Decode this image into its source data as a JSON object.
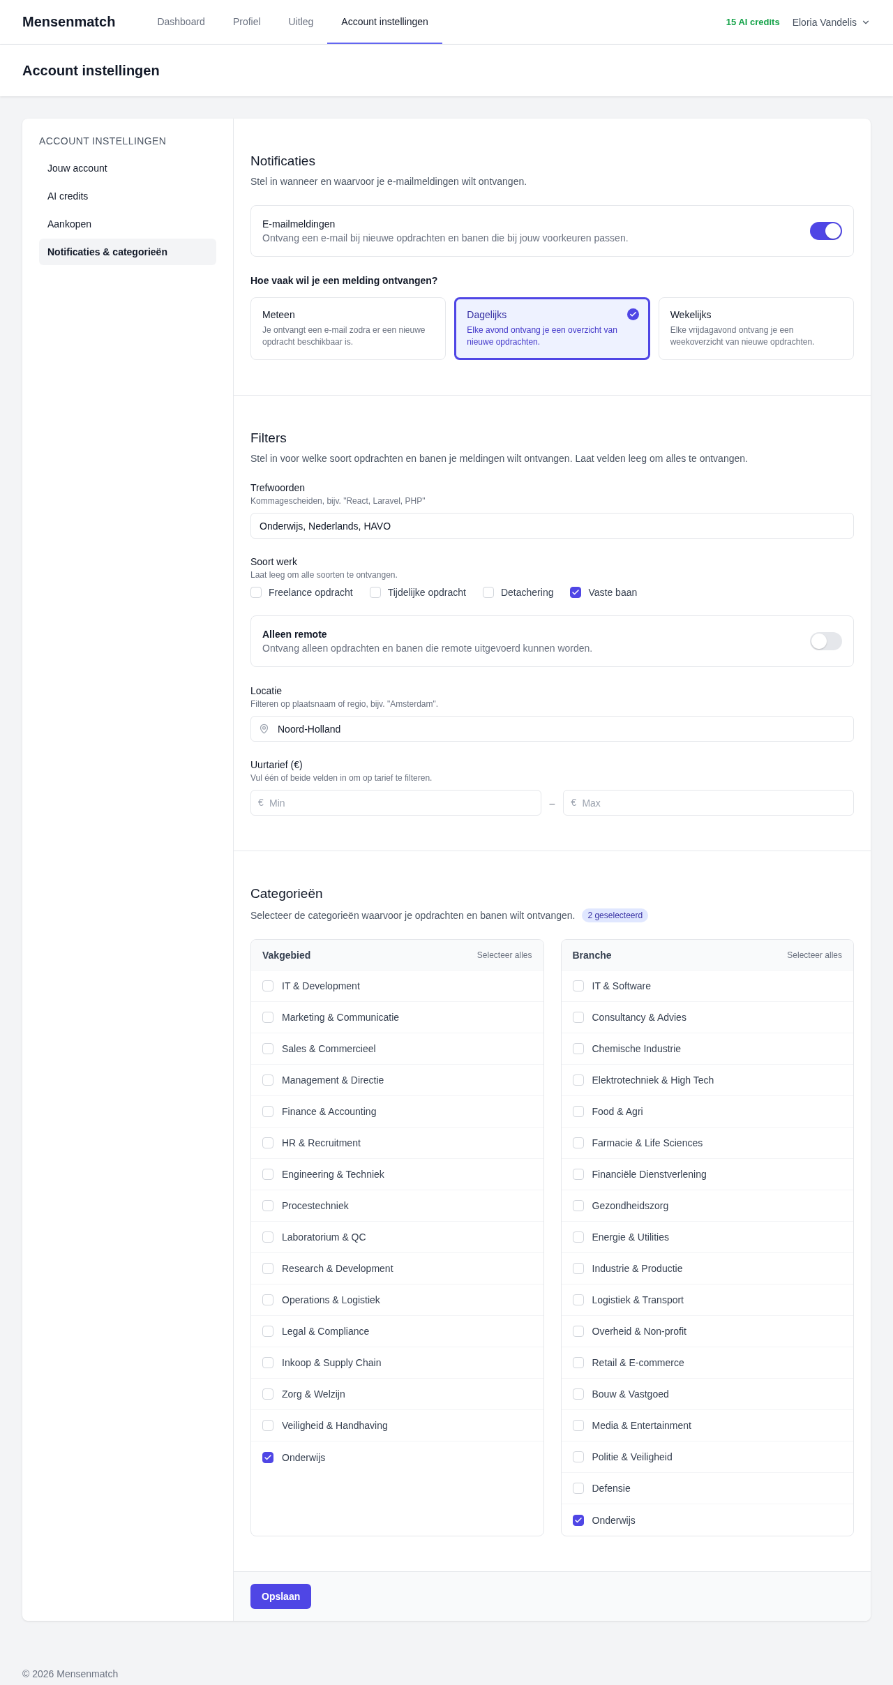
{
  "nav": {
    "brand": "Mensenmatch",
    "links": [
      {
        "label": "Dashboard",
        "selected": false
      },
      {
        "label": "Profiel",
        "selected": false
      },
      {
        "label": "Uitleg",
        "selected": false
      },
      {
        "label": "Account instellingen",
        "selected": true
      }
    ],
    "credits": "15 AI credits",
    "user": "Eloria Vandelis"
  },
  "page_title": "Account instellingen",
  "sidebar": {
    "heading": "ACCOUNT INSTELLINGEN",
    "items": [
      {
        "label": "Jouw account",
        "selected": false
      },
      {
        "label": "AI credits",
        "selected": false
      },
      {
        "label": "Aankopen",
        "selected": false
      },
      {
        "label": "Notificaties & categorieën",
        "selected": true
      }
    ]
  },
  "notifications": {
    "title": "Notificaties",
    "description": "Stel in wanneer en waarvoor je e-mailmeldingen wilt ontvangen.",
    "email_toggle": {
      "title": "E-mailmeldingen",
      "description": "Ontvang een e-mail bij nieuwe opdrachten en banen die bij jouw voorkeuren passen.",
      "on": true
    },
    "frequency_question": "Hoe vaak wil je een melding ontvangen?",
    "options": [
      {
        "title": "Meteen",
        "description": "Je ontvangt een e-mail zodra er een nieuwe opdracht beschikbaar is.",
        "selected": false
      },
      {
        "title": "Dagelijks",
        "description": "Elke avond ontvang je een overzicht van nieuwe opdrachten.",
        "selected": true
      },
      {
        "title": "Wekelijks",
        "description": "Elke vrijdagavond ontvang je een weekoverzicht van nieuwe opdrachten.",
        "selected": false
      }
    ]
  },
  "filters": {
    "title": "Filters",
    "description": "Stel in voor welke soort opdrachten en banen je meldingen wilt ontvangen. Laat velden leeg om alles te ontvangen.",
    "keywords": {
      "label": "Trefwoorden",
      "hint": "Kommagescheiden, bijv. \"React, Laravel, PHP\"",
      "value": "Onderwijs, Nederlands, HAVO"
    },
    "work_type": {
      "label": "Soort werk",
      "hint": "Laat leeg om alle soorten te ontvangen.",
      "options": [
        {
          "label": "Freelance opdracht",
          "checked": false
        },
        {
          "label": "Tijdelijke opdracht",
          "checked": false
        },
        {
          "label": "Detachering",
          "checked": false
        },
        {
          "label": "Vaste baan",
          "checked": true
        }
      ]
    },
    "remote": {
      "title": "Alleen remote",
      "description": "Ontvang alleen opdrachten en banen die remote uitgevoerd kunnen worden.",
      "on": false
    },
    "location": {
      "label": "Locatie",
      "hint": "Filteren op plaatsnaam of regio, bijv. \"Amsterdam\".",
      "value": "Noord-Holland"
    },
    "rate": {
      "label": "Uurtarief (€)",
      "hint": "Vul één of beide velden in om op tarief te filteren.",
      "min": {
        "prefix": "€",
        "placeholder": "Min"
      },
      "separator": "–",
      "max": {
        "prefix": "€",
        "placeholder": "Max"
      }
    }
  },
  "categories": {
    "title": "Categorieën",
    "description": "Selecteer de categorieën waarvoor je opdrachten en banen wilt ontvangen.",
    "badge": "2 geselecteerd",
    "lists": [
      {
        "title": "Vakgebied",
        "select_all": "Selecteer alles",
        "items": [
          {
            "label": "IT & Development",
            "checked": false
          },
          {
            "label": "Marketing & Communicatie",
            "checked": false
          },
          {
            "label": "Sales & Commercieel",
            "checked": false
          },
          {
            "label": "Management & Directie",
            "checked": false
          },
          {
            "label": "Finance & Accounting",
            "checked": false
          },
          {
            "label": "HR & Recruitment",
            "checked": false
          },
          {
            "label": "Engineering & Techniek",
            "checked": false
          },
          {
            "label": "Procestechniek",
            "checked": false
          },
          {
            "label": "Laboratorium & QC",
            "checked": false
          },
          {
            "label": "Research & Development",
            "checked": false
          },
          {
            "label": "Operations & Logistiek",
            "checked": false
          },
          {
            "label": "Legal & Compliance",
            "checked": false
          },
          {
            "label": "Inkoop & Supply Chain",
            "checked": false
          },
          {
            "label": "Zorg & Welzijn",
            "checked": false
          },
          {
            "label": "Veiligheid & Handhaving",
            "checked": false
          },
          {
            "label": "Onderwijs",
            "checked": true
          }
        ]
      },
      {
        "title": "Branche",
        "select_all": "Selecteer alles",
        "items": [
          {
            "label": "IT & Software",
            "checked": false
          },
          {
            "label": "Consultancy & Advies",
            "checked": false
          },
          {
            "label": "Chemische Industrie",
            "checked": false
          },
          {
            "label": "Elektrotechniek & High Tech",
            "checked": false
          },
          {
            "label": "Food & Agri",
            "checked": false
          },
          {
            "label": "Farmacie & Life Sciences",
            "checked": false
          },
          {
            "label": "Financiële Dienstverlening",
            "checked": false
          },
          {
            "label": "Gezondheidszorg",
            "checked": false
          },
          {
            "label": "Energie & Utilities",
            "checked": false
          },
          {
            "label": "Industrie & Productie",
            "checked": false
          },
          {
            "label": "Logistiek & Transport",
            "checked": false
          },
          {
            "label": "Overheid & Non-profit",
            "checked": false
          },
          {
            "label": "Retail & E-commerce",
            "checked": false
          },
          {
            "label": "Bouw & Vastgoed",
            "checked": false
          },
          {
            "label": "Media & Entertainment",
            "checked": false
          },
          {
            "label": "Politie & Veiligheid",
            "checked": false
          },
          {
            "label": "Defensie",
            "checked": false
          },
          {
            "label": "Onderwijs",
            "checked": true
          }
        ]
      }
    ]
  },
  "save_button": "Opslaan",
  "footer": "© 2026 Mensenmatch"
}
